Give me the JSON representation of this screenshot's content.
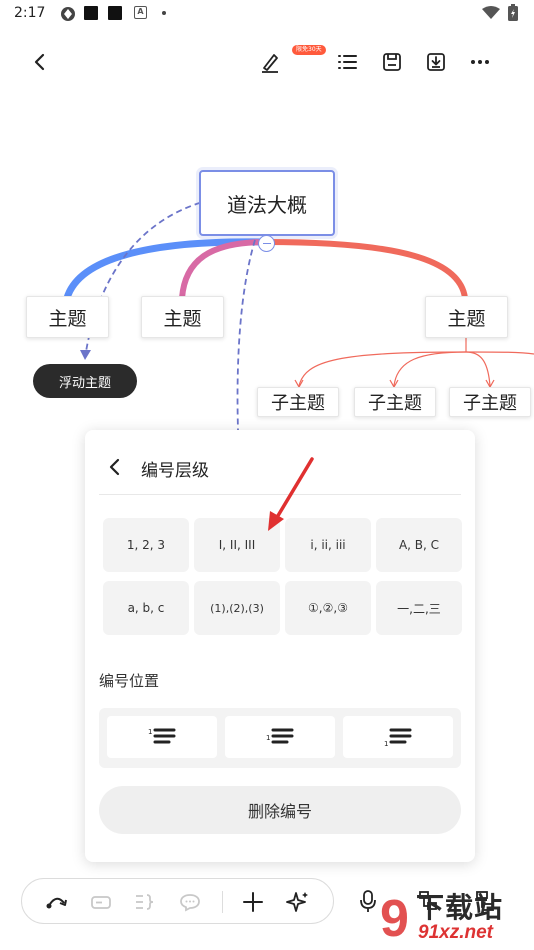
{
  "status_bar": {
    "time": "2:17",
    "notification_icon_letter": "A"
  },
  "toolbar": {
    "vip_badge": "限免30天"
  },
  "mindmap": {
    "central_topic": "道法大概",
    "topics": [
      "主题",
      "主题",
      "主题"
    ],
    "subtopics": [
      "子主题",
      "子主题",
      "子主题"
    ],
    "floating_topic": "浮动主题",
    "colors": {
      "blue": "#5b8ff9",
      "pink": "#d86aa5",
      "red": "#f06a5c",
      "relation": "#6b74c9"
    }
  },
  "numbering_panel": {
    "title": "编号层级",
    "options": [
      "1, 2, 3",
      "I, II, III",
      "i, ii, iii",
      "A, B, C",
      "a, b, c",
      "(1),(2),(3)",
      "①,②,③",
      "一,二,三"
    ],
    "position_label": "编号位置",
    "position_options": [
      {
        "icon": "number-left-align-icon",
        "marker": "1"
      },
      {
        "icon": "number-middle-align-icon",
        "marker": "1"
      },
      {
        "icon": "number-bottom-align-icon",
        "marker": "1"
      }
    ],
    "delete_label": "删除编号"
  },
  "watermark": {
    "text": "下载站",
    "url": "91xz.net",
    "logo_digit": "9"
  }
}
